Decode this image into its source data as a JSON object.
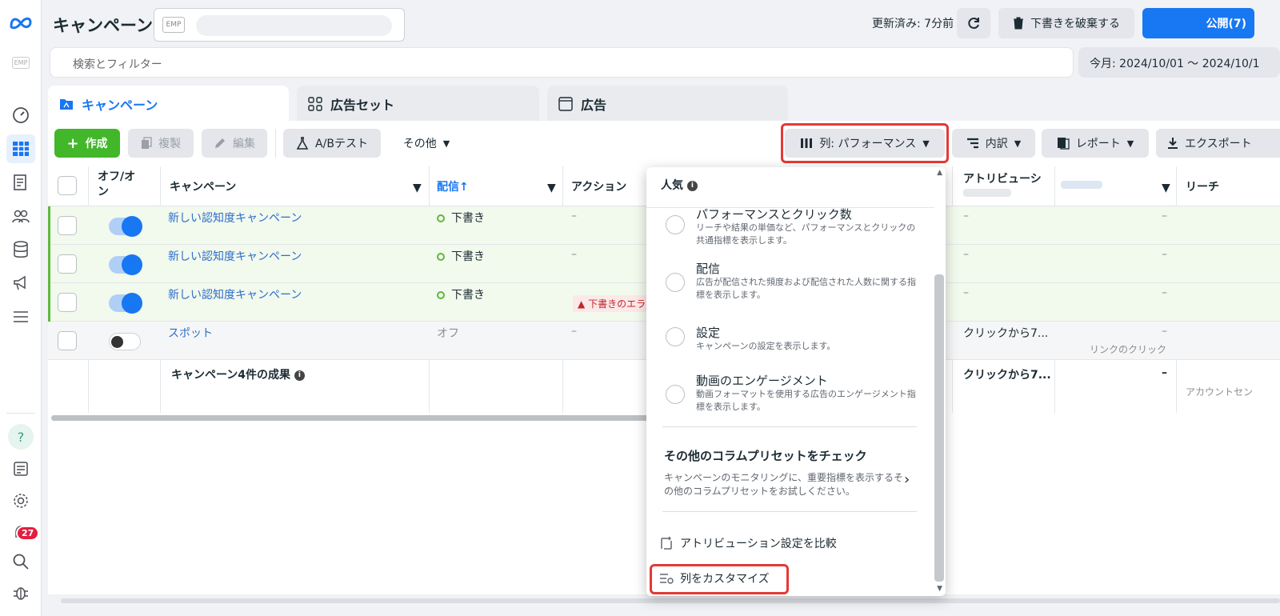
{
  "rail": {
    "brand_icon": "meta-logo-icon",
    "account_logo": "EMP",
    "items": [
      "dashboard-icon",
      "campaigns-table-icon",
      "reports-icon",
      "audiences-icon",
      "catalog-icon",
      "ads-icon",
      "menu-icon"
    ],
    "bottom": [
      "help-icon",
      "news-icon",
      "settings-icon",
      "notifications-icon",
      "search-icon",
      "bug-icon"
    ],
    "notification_count": "27"
  },
  "header": {
    "title": "キャンペーン",
    "account_logo": "EMP",
    "updated": "更新済み: 7分前",
    "discard": "下書きを破棄する",
    "publish": "公開(7)"
  },
  "search": {
    "placeholder": "検索とフィルター"
  },
  "date_range": "今月: 2024/10/01 ～ 2024/10/1",
  "tabs": [
    {
      "label": "キャンペーン"
    },
    {
      "label": "広告セット"
    },
    {
      "label": "広告"
    }
  ],
  "toolbar": {
    "create": "作成",
    "duplicate": "複製",
    "edit": "編集",
    "abtest": "A/Bテスト",
    "more": "その他",
    "columns": "列: パフォーマンス",
    "breakdown": "内訳",
    "report": "レポート",
    "export": "エクスポート"
  },
  "table": {
    "headers": {
      "onoff": "オフ/オン",
      "campaign": "キャンペーン",
      "delivery": "配信↑",
      "action": "アクション",
      "attribution": "アトリビューシ",
      "reach": "リーチ"
    },
    "rows": [
      {
        "name": "新しい認知度キャンペーン",
        "delivery": "下書き",
        "action": "–",
        "attribution": "–",
        "col7": "–",
        "state": "on"
      },
      {
        "name": "新しい認知度キャンペーン",
        "delivery": "下書き",
        "action": "–",
        "attribution": "–",
        "col7": "–",
        "state": "on"
      },
      {
        "name": "新しい認知度キャンペーン",
        "delivery": "下書き",
        "action": "下書きのエラ",
        "attribution": "–",
        "col7": "–",
        "state": "on"
      },
      {
        "name": "スポット",
        "delivery": "オフ",
        "action": "–",
        "attribution": "クリックから7...",
        "col7": "–",
        "col7_sub": "リンクのクリック",
        "state": "off"
      }
    ],
    "summary": {
      "label": "キャンペーン4件の成果",
      "attribution": "クリックから7...",
      "col7": "–",
      "reach": "アカウントセン"
    }
  },
  "dropdown": {
    "popular": "人気",
    "options": [
      {
        "title": "パフォーマンスとクリック数",
        "desc": "リーチや結果の単価など、パフォーマンスとクリックの共通指標を表示します。"
      },
      {
        "title": "配信",
        "desc": "広告が配信された頻度および配信された人数に関する指標を表示します。"
      },
      {
        "title": "設定",
        "desc": "キャンペーンの設定を表示します。"
      },
      {
        "title": "動画のエンゲージメント",
        "desc": "動画フォーマットを使用する広告のエンゲージメント指標を表示します。"
      }
    ],
    "more_title": "その他のコラムプリセットをチェック",
    "more_desc": "キャンペーンのモニタリングに、重要指標を表示するその他のコラムプリセットをお試しください。",
    "compare": "アトリビューション設定を比較",
    "customize": "列をカスタマイズ"
  },
  "colors": {
    "accent": "#1877f2",
    "create": "#42b72a",
    "highlight": "#e53935"
  }
}
